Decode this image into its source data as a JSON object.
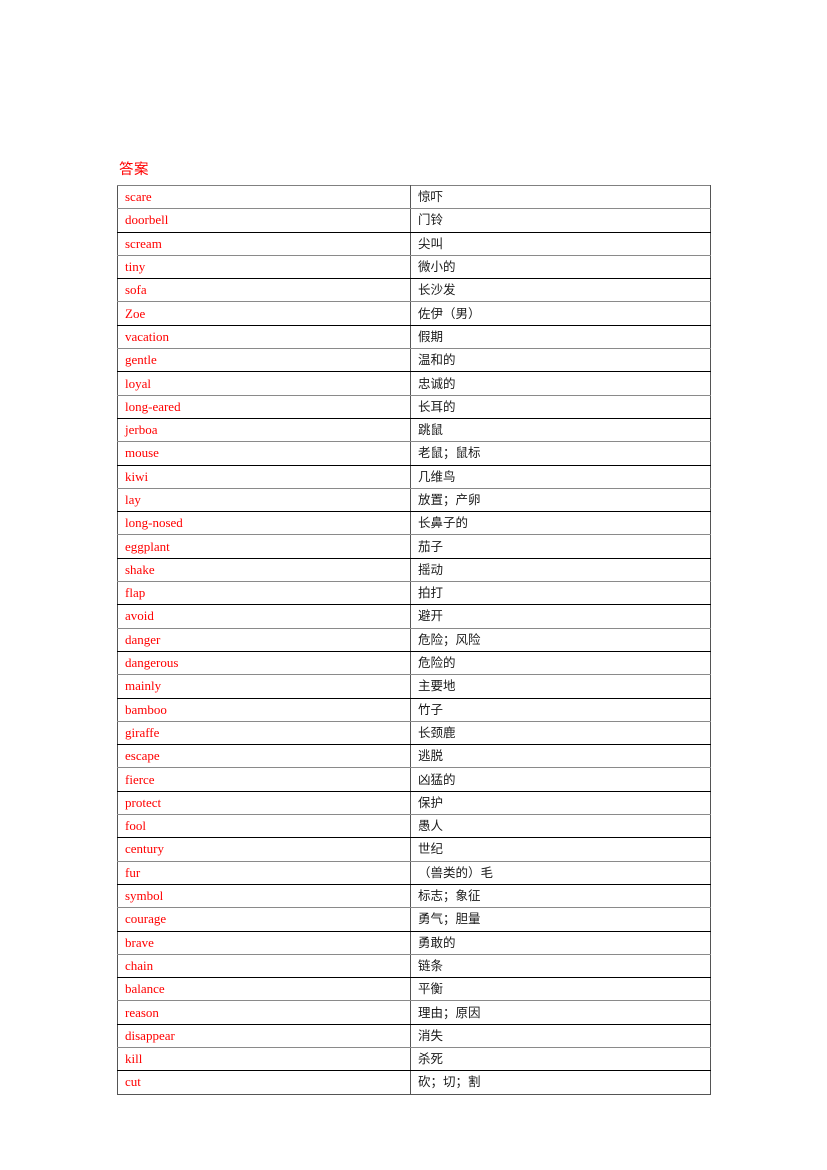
{
  "document": {
    "section_heading": "答案",
    "table": {
      "rows": [
        {
          "english": "scare",
          "chinese": "惊吓"
        },
        {
          "english": "doorbell",
          "chinese": "门铃"
        },
        {
          "english": "scream",
          "chinese": "尖叫"
        },
        {
          "english": "tiny",
          "chinese": "微小的"
        },
        {
          "english": "sofa",
          "chinese": "长沙发"
        },
        {
          "english": "Zoe",
          "chinese": "佐伊（男）"
        },
        {
          "english": "vacation",
          "chinese": "假期"
        },
        {
          "english": "gentle",
          "chinese": "温和的"
        },
        {
          "english": "loyal",
          "chinese": "忠诚的"
        },
        {
          "english": "long-eared",
          "chinese": "长耳的"
        },
        {
          "english": "jerboa",
          "chinese": "跳鼠"
        },
        {
          "english": "mouse",
          "chinese": "老鼠；鼠标"
        },
        {
          "english": "kiwi",
          "chinese": "几维鸟"
        },
        {
          "english": "lay",
          "chinese": "放置；产卵"
        },
        {
          "english": "long-nosed",
          "chinese": "长鼻子的"
        },
        {
          "english": "eggplant",
          "chinese": "茄子"
        },
        {
          "english": "shake",
          "chinese": "摇动"
        },
        {
          "english": "flap",
          "chinese": "拍打"
        },
        {
          "english": "avoid",
          "chinese": "避开"
        },
        {
          "english": "danger",
          "chinese": "危险；风险"
        },
        {
          "english": "dangerous",
          "chinese": "危险的"
        },
        {
          "english": "mainly",
          "chinese": "主要地"
        },
        {
          "english": "bamboo",
          "chinese": "竹子"
        },
        {
          "english": "giraffe",
          "chinese": "长颈鹿"
        },
        {
          "english": "escape",
          "chinese": "逃脱"
        },
        {
          "english": "fierce",
          "chinese": "凶猛的"
        },
        {
          "english": "protect",
          "chinese": "保护"
        },
        {
          "english": "fool",
          "chinese": "愚人"
        },
        {
          "english": "century",
          "chinese": "世纪"
        },
        {
          "english": "fur",
          "chinese": "（兽类的）毛"
        },
        {
          "english": "symbol",
          "chinese": "标志；象征"
        },
        {
          "english": "courage",
          "chinese": "勇气；胆量"
        },
        {
          "english": "brave",
          "chinese": "勇敢的"
        },
        {
          "english": "chain",
          "chinese": "链条"
        },
        {
          "english": "balance",
          "chinese": "平衡"
        },
        {
          "english": "reason",
          "chinese": "理由；原因"
        },
        {
          "english": "disappear",
          "chinese": "消失"
        },
        {
          "english": "kill",
          "chinese": "杀死"
        },
        {
          "english": "cut",
          "chinese": "砍；切；割"
        }
      ]
    }
  },
  "colors": {
    "english_text": "#ff0000",
    "chinese_text": "#1a1a1a",
    "heading": "#ff0000",
    "border_dark": "#000000",
    "border_light": "#8a8a8a"
  }
}
